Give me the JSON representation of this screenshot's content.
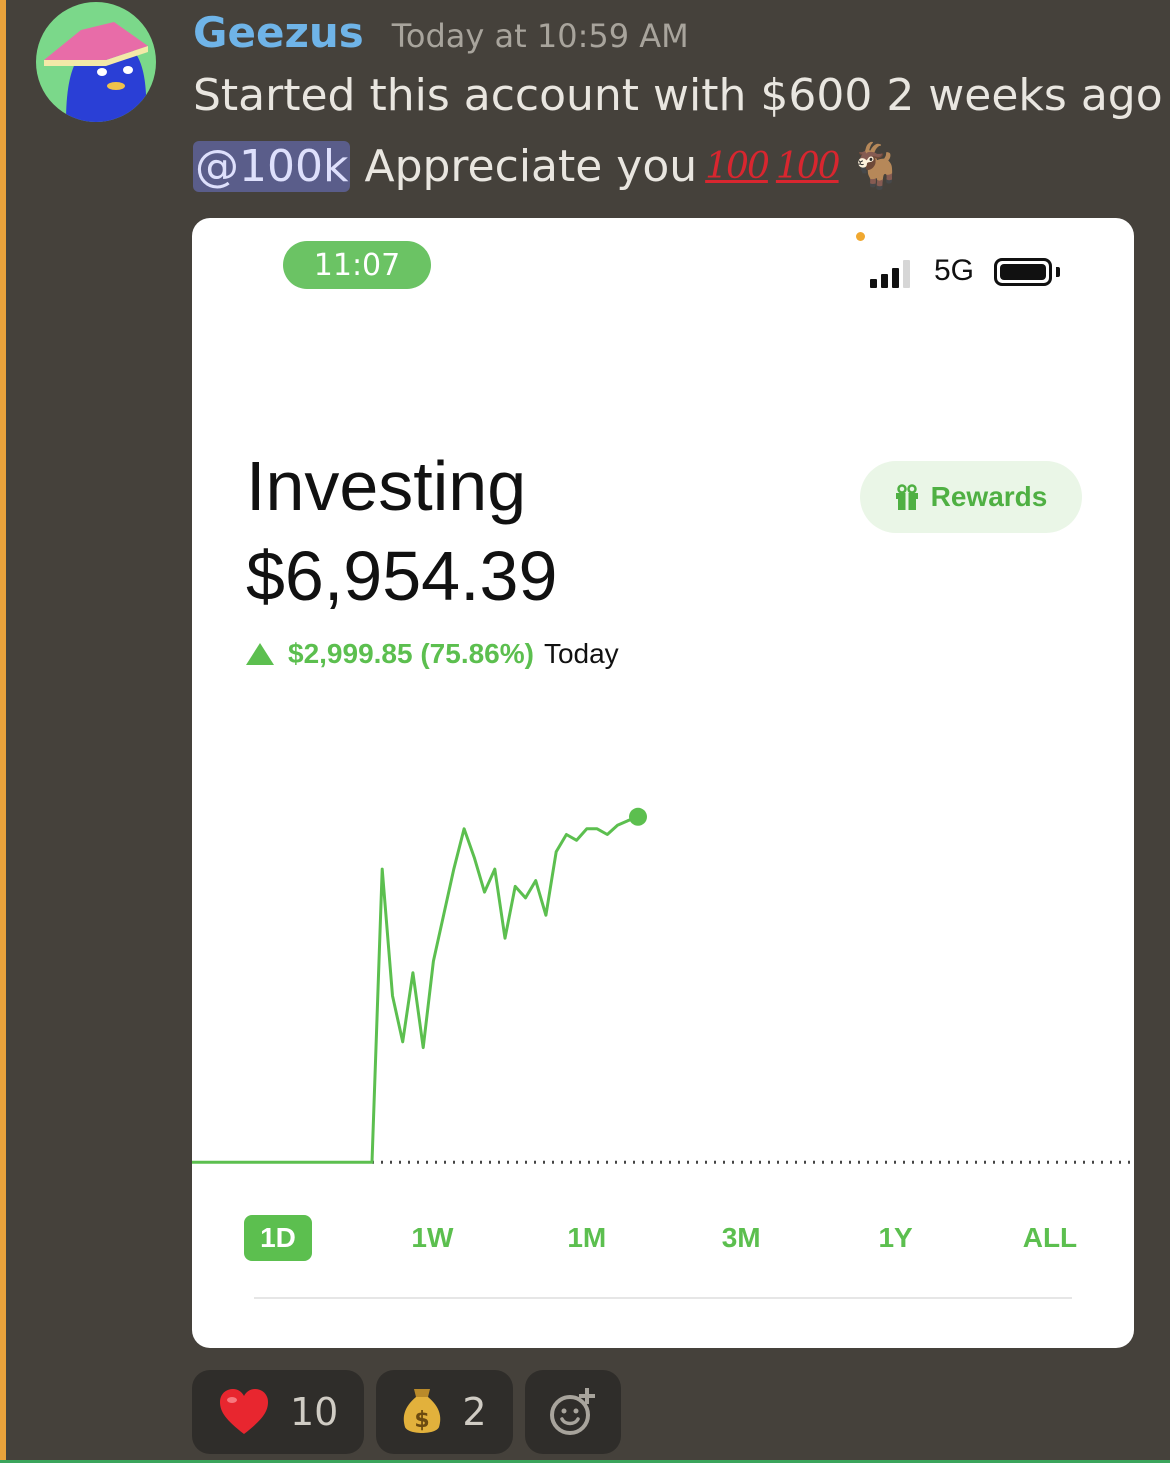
{
  "message": {
    "username": "Geezus",
    "timestamp": "Today at 10:59 AM",
    "line1": "Started this account with $600 2 weeks ago",
    "mention": "@100k",
    "line2_text": "Appreciate you",
    "emoji_hundred": "100",
    "goat_emoji": "🐐"
  },
  "phone": {
    "status_time": "11:07",
    "network": "5G",
    "title": "Investing",
    "balance": "$6,954.39",
    "change_amount": "$2,999.85 (75.86%)",
    "change_label": "Today",
    "rewards_label": "Rewards",
    "ranges": [
      "1D",
      "1W",
      "1M",
      "3M",
      "1Y",
      "ALL"
    ],
    "active_range": "1D",
    "accent_color": "#5cbf4f"
  },
  "reactions": [
    {
      "icon": "heart-icon",
      "count": "10"
    },
    {
      "icon": "money-bag-icon",
      "count": "2"
    }
  ],
  "chart_data": {
    "type": "line",
    "series": [
      {
        "values": [
          3954.5,
          3954.5,
          3954.5,
          3954.5,
          6500,
          5400,
          5000,
          5600,
          4950,
          5700,
          6100,
          6500,
          6850,
          6600,
          6300,
          6500,
          5900,
          6350,
          6250,
          6400,
          6100,
          6650,
          6800,
          6750,
          6850,
          6850,
          6800,
          6880,
          6920,
          6954.4
        ]
      }
    ],
    "baseline": 3954.54,
    "ylim": [
      3800,
      7100
    ],
    "grid": false
  }
}
